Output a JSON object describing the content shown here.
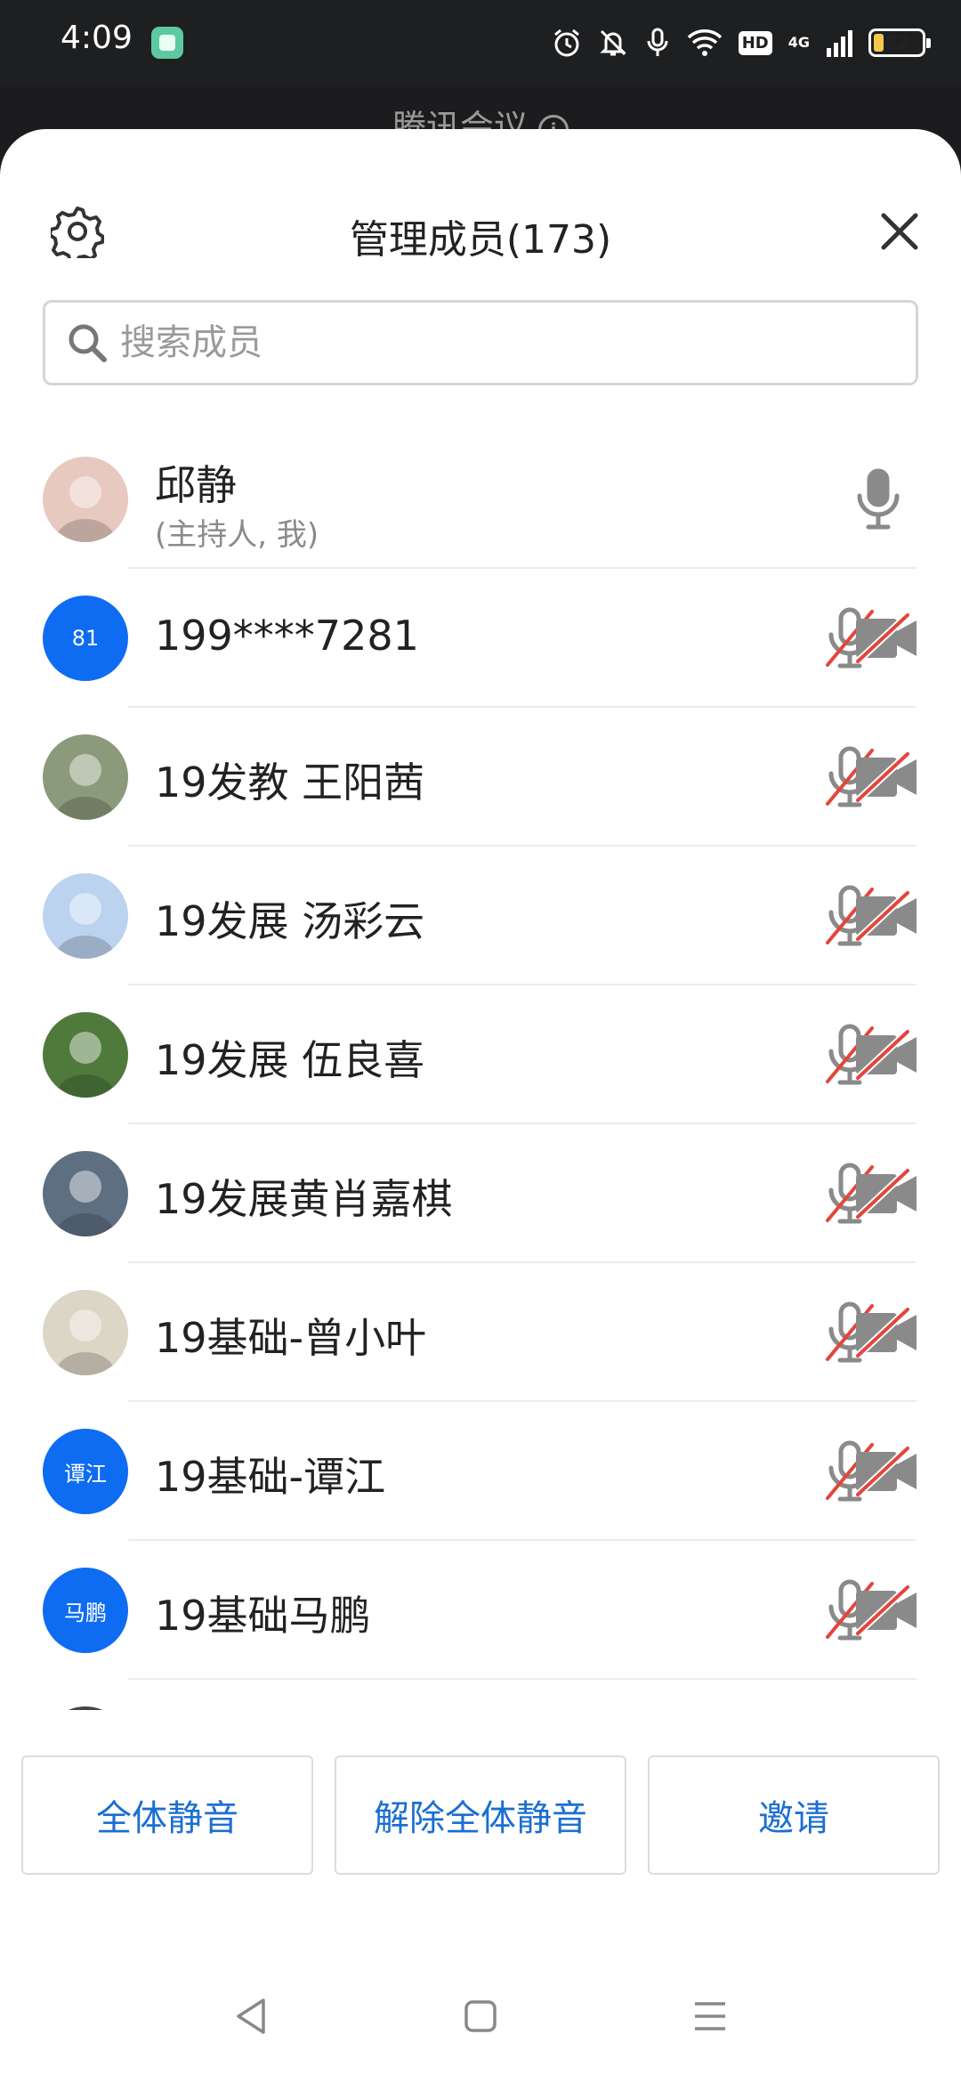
{
  "status_bar": {
    "time": "4:09",
    "battery": "22",
    "battery_level": 0.22,
    "hd_label": "HD",
    "network_label": "4G",
    "icons": [
      "app-icon",
      "alarm-icon",
      "bell-muted-icon",
      "mic-icon",
      "wifi-icon",
      "hd-icon",
      "signal-icon",
      "battery-icon"
    ]
  },
  "underlying": {
    "title": "腾讯会议"
  },
  "header": {
    "title": "管理成员(173)",
    "settings_icon": "gear-icon",
    "close_icon": "close-icon"
  },
  "search": {
    "placeholder": "搜索成员",
    "value": ""
  },
  "members": [
    {
      "name": "邱静",
      "role": "(主持人, 我)",
      "avatar_type": "photo",
      "avatar_color": "#e7c9c0",
      "mic": "on",
      "camera": "none"
    },
    {
      "name": "199****7281",
      "avatar_type": "text",
      "avatar_text": "81",
      "mic": "muted",
      "camera": "off"
    },
    {
      "name": "19发教 王阳茜",
      "avatar_type": "photo",
      "avatar_color": "#8b9a7a",
      "mic": "muted",
      "camera": "off"
    },
    {
      "name": "19发展 汤彩云",
      "avatar_type": "photo",
      "avatar_color": "#bcd3ef",
      "mic": "muted",
      "camera": "off"
    },
    {
      "name": "19发展 伍良喜",
      "avatar_type": "photo",
      "avatar_color": "#4f7a3c",
      "mic": "muted",
      "camera": "off"
    },
    {
      "name": "19发展黄肖嘉棋",
      "avatar_type": "photo",
      "avatar_color": "#5e6f82",
      "mic": "muted",
      "camera": "off"
    },
    {
      "name": "19基础-曾小叶",
      "avatar_type": "photo",
      "avatar_color": "#dcd6c6",
      "mic": "muted",
      "camera": "off"
    },
    {
      "name": "19基础-谭江",
      "avatar_type": "text",
      "avatar_text": "谭江",
      "mic": "muted",
      "camera": "off"
    },
    {
      "name": "19基础马鹏",
      "avatar_type": "text",
      "avatar_text": "马鹏",
      "mic": "muted",
      "camera": "off"
    }
  ],
  "actions": {
    "mute_all": "全体静音",
    "unmute_all": "解除全体静音",
    "invite": "邀请"
  },
  "colors": {
    "accent": "#1a6fd1",
    "avatar_blue": "#0e6cf2",
    "muted_red": "#e2463c",
    "icon_gray": "#8a8a8a"
  },
  "nav": {
    "icons": [
      "back-icon",
      "home-icon",
      "menu-icon"
    ]
  }
}
